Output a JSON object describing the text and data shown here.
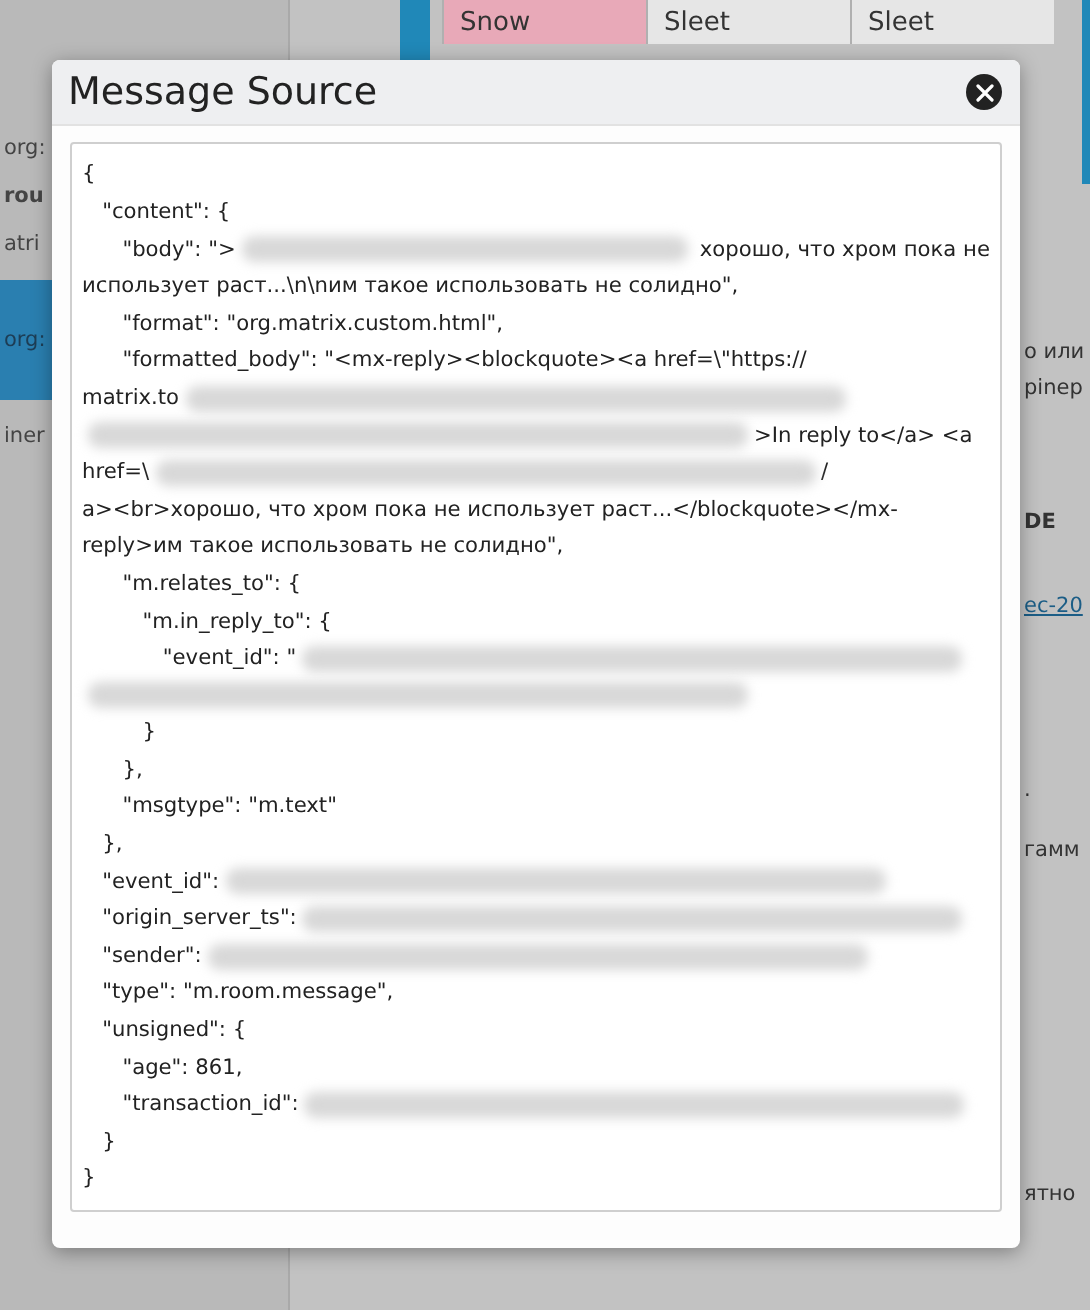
{
  "background": {
    "sidebar": [
      {
        "text": "org:",
        "selected": false
      },
      {
        "text": "rou",
        "selected": false
      },
      {
        "text": "atri",
        "selected": false
      },
      {
        "text": "org:",
        "selected": true
      },
      {
        "text": "iner",
        "selected": false
      }
    ],
    "weather": [
      {
        "text": "Snow",
        "color": "#e8a9b8"
      },
      {
        "text": "Sleet",
        "color": "#e6e6e6"
      },
      {
        "text": "Sleet",
        "color": "#e6e6e6"
      }
    ],
    "fragments": [
      {
        "kind": "text",
        "text": "о или"
      },
      {
        "kind": "text",
        "text": "pinep"
      },
      {
        "kind": "heading",
        "text": "DE"
      },
      {
        "kind": "link",
        "text": "ec-20"
      },
      {
        "kind": "text",
        "text": "."
      },
      {
        "kind": "text",
        "text": "гамм"
      },
      {
        "kind": "text",
        "text": "ятно"
      }
    ]
  },
  "dialog": {
    "title": "Message Source",
    "lines": [
      {
        "parts": [
          {
            "kind": "text",
            "text": "{"
          }
        ]
      },
      {
        "parts": [
          {
            "kind": "text",
            "text": "   \"content\": {"
          }
        ]
      },
      {
        "parts": [
          {
            "kind": "text",
            "text": "      \"body\": \">"
          },
          {
            "kind": "redacted"
          },
          {
            "kind": "text",
            "text": " хорошо, что хром пока не"
          }
        ]
      },
      {
        "parts": [
          {
            "kind": "text",
            "text": "использует раст...\\n\\nим такое использовать не солидно\","
          }
        ]
      },
      {
        "parts": [
          {
            "kind": "text",
            "text": "      \"format\": \"org.matrix.custom.html\","
          }
        ]
      },
      {
        "parts": [
          {
            "kind": "text",
            "text": "      \"formatted_body\": \"<mx-reply><blockquote><a href=\\\"https://"
          }
        ]
      },
      {
        "parts": [
          {
            "kind": "text",
            "text": "matrix.to"
          },
          {
            "kind": "redacted"
          }
        ]
      },
      {
        "parts": [
          {
            "kind": "redacted"
          },
          {
            "kind": "text",
            "text": ">In reply to</a> <a"
          }
        ]
      },
      {
        "parts": [
          {
            "kind": "text",
            "text": "href=\\"
          },
          {
            "kind": "redacted"
          },
          {
            "kind": "text",
            "text": "/"
          }
        ]
      },
      {
        "parts": [
          {
            "kind": "text",
            "text": "a><br>хорошо, что хром пока не использует раст...</blockquote></mx-"
          }
        ]
      },
      {
        "parts": [
          {
            "kind": "text",
            "text": "reply>им такое использовать не солидно\","
          }
        ]
      },
      {
        "parts": [
          {
            "kind": "text",
            "text": "      \"m.relates_to\": {"
          }
        ]
      },
      {
        "parts": [
          {
            "kind": "text",
            "text": "         \"m.in_reply_to\": {"
          }
        ]
      },
      {
        "parts": [
          {
            "kind": "text",
            "text": "            \"event_id\": \""
          },
          {
            "kind": "redacted"
          }
        ]
      },
      {
        "parts": [
          {
            "kind": "redacted"
          }
        ]
      },
      {
        "parts": [
          {
            "kind": "text",
            "text": "         }"
          }
        ]
      },
      {
        "parts": [
          {
            "kind": "text",
            "text": "      },"
          }
        ]
      },
      {
        "parts": [
          {
            "kind": "text",
            "text": "      \"msgtype\": \"m.text\""
          }
        ]
      },
      {
        "parts": [
          {
            "kind": "text",
            "text": "   },"
          }
        ]
      },
      {
        "parts": [
          {
            "kind": "text",
            "text": "   \"event_id\":"
          },
          {
            "kind": "redacted"
          }
        ]
      },
      {
        "parts": [
          {
            "kind": "text",
            "text": "   \"origin_server_ts\":"
          },
          {
            "kind": "redacted"
          }
        ]
      },
      {
        "parts": [
          {
            "kind": "text",
            "text": "   \"sender\":"
          },
          {
            "kind": "redacted"
          }
        ]
      },
      {
        "parts": [
          {
            "kind": "text",
            "text": "   \"type\": \"m.room.message\","
          }
        ]
      },
      {
        "parts": [
          {
            "kind": "text",
            "text": "   \"unsigned\": {"
          }
        ]
      },
      {
        "parts": [
          {
            "kind": "text",
            "text": "      \"age\": 861,"
          }
        ]
      },
      {
        "parts": [
          {
            "kind": "text",
            "text": "      \"transaction_id\":"
          },
          {
            "kind": "redacted"
          }
        ]
      },
      {
        "parts": [
          {
            "kind": "text",
            "text": "   }"
          }
        ]
      },
      {
        "parts": [
          {
            "kind": "text",
            "text": "}"
          }
        ]
      }
    ]
  }
}
